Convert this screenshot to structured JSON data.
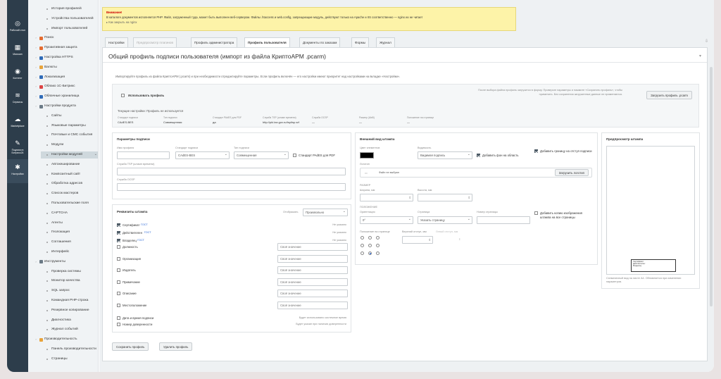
{
  "left_bar": [
    {
      "icon": "dashboard-icon",
      "label": "Рабочий стол"
    },
    {
      "icon": "shop-icon",
      "label": "Магазин"
    },
    {
      "icon": "content-icon",
      "label": "Контент"
    },
    {
      "icon": "services-icon",
      "label": "Сервисы"
    },
    {
      "icon": "cloud-icon",
      "label": "Marketplace"
    },
    {
      "icon": "sign-icon",
      "label": "Подписи в Битрикс24"
    },
    {
      "icon": "gear-icon",
      "label": "Настройки"
    }
  ],
  "nav": [
    {
      "label": "История профилей",
      "indent": 2,
      "type": "dot"
    },
    {
      "label": "Устройства пользователей",
      "indent": 2,
      "type": "dot"
    },
    {
      "label": "Импорт пользователей",
      "indent": 2,
      "type": "dot"
    },
    {
      "label": "Поиск",
      "indent": 1,
      "type": "icon",
      "color": "#e56c30"
    },
    {
      "label": "Проактивная защита",
      "indent": 1,
      "type": "icon",
      "color": "#e56c30"
    },
    {
      "label": "Настройка HTTPS",
      "indent": 1,
      "type": "icon",
      "color": "#2f6bb8"
    },
    {
      "label": "Валюты",
      "indent": 1,
      "type": "icon",
      "color": "#e8a33a"
    },
    {
      "label": "Локализация",
      "indent": 1,
      "type": "icon",
      "color": "#2f6bb8"
    },
    {
      "label": "Облако 1С-Битрикс",
      "indent": 1,
      "type": "icon",
      "color": "#d44"
    },
    {
      "label": "Облачные хранилища",
      "indent": 1,
      "type": "icon",
      "color": "#2f6bb8"
    },
    {
      "label": "Настройки продукта",
      "indent": 1,
      "type": "icon",
      "color": "#6b7a86"
    },
    {
      "label": "Сайты",
      "indent": 2,
      "type": "dot"
    },
    {
      "label": "Языковые параметры",
      "indent": 2,
      "type": "dot"
    },
    {
      "label": "Почтовые и СМС события",
      "indent": 2,
      "type": "dot"
    },
    {
      "label": "Модули",
      "indent": 2,
      "type": "dot"
    },
    {
      "label": "Настройки модулей",
      "indent": 2,
      "type": "dot",
      "selected": true
    },
    {
      "label": "Автокеширование",
      "indent": 2,
      "type": "dot"
    },
    {
      "label": "Композитный сайт",
      "indent": 2,
      "type": "dot"
    },
    {
      "label": "Обработка адресов",
      "indent": 2,
      "type": "dot"
    },
    {
      "label": "Список мастеров",
      "indent": 2,
      "type": "dot"
    },
    {
      "label": "Пользовательские поля",
      "indent": 2,
      "type": "dot"
    },
    {
      "label": "CAPTCHA",
      "indent": 2,
      "type": "dot"
    },
    {
      "label": "Агенты",
      "indent": 2,
      "type": "dot"
    },
    {
      "label": "Геолокация",
      "indent": 2,
      "type": "dot"
    },
    {
      "label": "Соглашения",
      "indent": 2,
      "type": "dot"
    },
    {
      "label": "Интерфейс",
      "indent": 2,
      "type": "dot"
    },
    {
      "label": "Инструменты",
      "indent": 1,
      "type": "icon",
      "color": "#6b7a86"
    },
    {
      "label": "Проверка системы",
      "indent": 2,
      "type": "dot"
    },
    {
      "label": "Монитор качества",
      "indent": 2,
      "type": "dot"
    },
    {
      "label": "SQL запрос",
      "indent": 2,
      "type": "dot"
    },
    {
      "label": "Командная PHP-строка",
      "indent": 2,
      "type": "dot"
    },
    {
      "label": "Резервное копирование",
      "indent": 2,
      "type": "dot"
    },
    {
      "label": "Диагностика",
      "indent": 2,
      "type": "dot"
    },
    {
      "label": "Журнал событий",
      "indent": 2,
      "type": "dot"
    },
    {
      "label": "Производительность",
      "indent": 1,
      "type": "icon",
      "color": "#e8a33a"
    },
    {
      "label": "Панель производительности",
      "indent": 2,
      "type": "dot"
    },
    {
      "label": "Страницы",
      "indent": 2,
      "type": "dot"
    }
  ],
  "warning": {
    "title": "Внимание!",
    "text": "В каталоге документов исполняется PHP. Файл, загруженный туда, может быть выполнен веб-сервером. Файлы .htaccess и web.config, запрещающие модуль, действуют только на Apache и IIS соответственно — nginx их не читает",
    "link": "Как закрыть на nginx"
  },
  "tabs": [
    "Настройки",
    "Предпросмотр плагинов",
    "Профиль администратора",
    "Профиль пользователя",
    "Документы по заказам",
    "Формы",
    "Журнал"
  ],
  "active_tab": 3,
  "page": {
    "title": "Общий профиль подписи пользователя (импорт из файла КриптоАРМ .pcarm)",
    "intro": "Импортируйте профиль из файла КриптоАРМ (.pcarm) и при необходимости отредактируйте параметры. Если профиль включён — его настройки имеют приоритет над настройками на вкладке «Настройки».",
    "use_profile": "Использовать профиль",
    "hint": "После выбора файла профиль загрузится в форму. Проверьте параметры и нажмите «Сохранить профиль», чтобы применить. Без сохранения загруженные данные не применяются.",
    "load_button": "Загрузить профиль .pcarm",
    "current_label": "Текущие настройки: Профиль не используется",
    "summary": [
      {
        "k": "Стандарт подписи",
        "v": "CAdES-BES"
      },
      {
        "k": "Тип подписи",
        "v": "Совмещенная"
      },
      {
        "k": "Стандарт PAdES для PDF",
        "v": "да"
      },
      {
        "k": "Служба TSP (штамп времени)",
        "v": "http://pki.tax.gov.ru/tsp/tsp.srf"
      },
      {
        "k": "Служба OCSP",
        "v": "—"
      },
      {
        "k": "Размер (ШхВ)",
        "v": "—"
      },
      {
        "k": "Положение на странице",
        "v": "—"
      }
    ]
  },
  "sig": {
    "title": "Параметры подписи",
    "name_label": "Имя профиля",
    "std_label": "Стандарт подписи",
    "std_value": "CAdES-BES",
    "type_label": "Тип подписи",
    "type_value": "Совмещенная",
    "pades": "Стандарт PAdES для PDF",
    "tsp_label": "Служба TSP (штамп времени)",
    "ocsp_label": "Служба OCSP"
  },
  "req": {
    "title": "Реквизиты штампа",
    "display_label": "Отображать",
    "display_value": "Произвольно",
    "rows": [
      {
        "label": "Сертификат",
        "tag": "ГОСТ",
        "right": "Не указано",
        "checked": true
      },
      {
        "label": "Действителен",
        "tag": "ГОСТ",
        "right": "Не указано",
        "checked": true
      },
      {
        "label": "Владелец",
        "tag": "ГОСТ",
        "right": "Не указано",
        "checked": true
      },
      {
        "label": "Должность",
        "placeholder": "Своё значение"
      },
      {
        "label": "Организация",
        "placeholder": "Своё значение"
      },
      {
        "label": "Издатель",
        "placeholder": "Своё значение"
      },
      {
        "label": "Примечание",
        "placeholder": "Своё значение"
      },
      {
        "label": "Описание",
        "placeholder": "Своё значение"
      },
      {
        "label": "Местоположение",
        "placeholder": "Своё значение"
      },
      {
        "label": "Дата и время подписи",
        "right": "Будет использовано системное время"
      },
      {
        "label": "Номер доверенности",
        "right": "Будет указан при наличии доверенности"
      }
    ]
  },
  "look": {
    "title": "Внешний вид штампа",
    "color_label": "Цвет элементов",
    "color": "#000000",
    "vis_label": "Видимость",
    "vis_value": "Видимая подпись",
    "bg_label": "Добавить фон на область",
    "border_label": "Добавить границу на отступ подписи",
    "logo_label": "Логотип",
    "logo_none": "Файл не выбран",
    "logo_button": "Загрузить логотип",
    "size_head": "РАЗМЕР",
    "width_label": "Ширина, мм",
    "height_label": "Высота, мм",
    "pos_head": "ПОЛОЖЕНИЕ",
    "orient_label": "Ориентация",
    "orient_value": "0°",
    "page_label": "Страница",
    "page_value": "Указать страницу",
    "pagenum_label": "Номер страницы",
    "copy_label": "Добавить копию изображения штампа на все страницы",
    "pagepos_label": "Положение на странице",
    "vmargin_label": "Верхний отступ, мм",
    "hmargin_label": "Левый отступ, мм",
    "radio_selected": 7
  },
  "preview": {
    "title": "Предпросмотр штампа",
    "mini_lines": [
      "Сертификат:",
      "Действителен:",
      "Владелец:"
    ],
    "caption": "Схематичный вид на листе А4. Обновляется при изменении параметров."
  },
  "buttons": {
    "save": "Сохранить профиль",
    "delete": "Удалить профиль"
  }
}
